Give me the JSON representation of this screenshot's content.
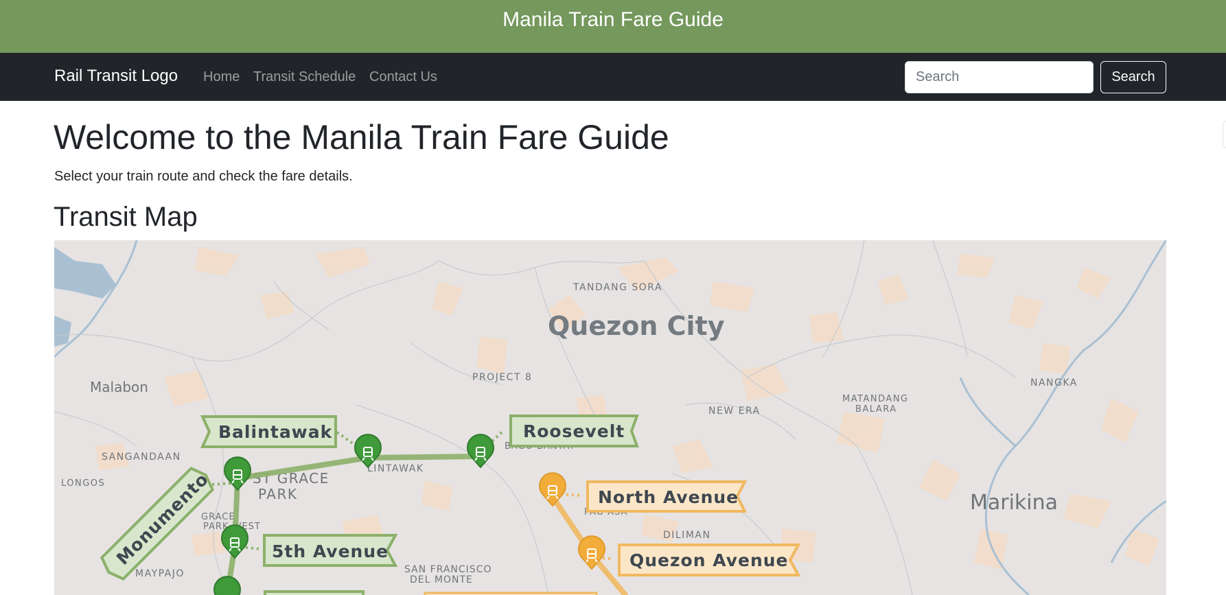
{
  "banner": {
    "title": "Manila Train Fare Guide"
  },
  "navbar": {
    "brand": "Rail Transit Logo",
    "links": [
      "Home",
      "Transit Schedule",
      "Contact Us"
    ],
    "search_placeholder": "Search",
    "search_button": "Search"
  },
  "main": {
    "heading": "Welcome to the Manila Train Fare Guide",
    "subtitle": "Select your train route and check the fare details.",
    "map_heading": "Transit Map"
  },
  "map": {
    "city_label": "Quezon City",
    "area_labels": {
      "malabon": "Malabon",
      "marikina": "Marikina",
      "tandang_sora": "TANDANG SORA",
      "project_8": "PROJECT 8",
      "new_era": "NEW ERA",
      "matandang_balara_1": "MATANDANG",
      "matandang_balara_2": "BALARA",
      "nangka": "NANGKA",
      "sangandaan": "SANGANDAAN",
      "longos": "LONGOS",
      "grace_park_1": "GRACE",
      "grace_park_2": "PARK WEST",
      "east_grace_park_1": "ST GRACE",
      "east_grace_park_2": "PARK",
      "balintawak_area": "LINTAWAK",
      "maypajo": "MAYPAJO",
      "diliman": "DILIMAN",
      "san_francisco_1": "SAN FRANCISCO",
      "san_francisco_2": "DEL MONTE",
      "bago_bantay": "BAGO BANTAY",
      "bago_pag_asa": "PAG-ASA"
    },
    "stations": {
      "balintawak": "Balintawak",
      "roosevelt": "Roosevelt",
      "monumento": "Monumento",
      "fifth_avenue": "5th Avenue",
      "north_avenue": "North Avenue",
      "quezon_avenue": "Quezon Avenue"
    },
    "colors": {
      "line1": "#8cb06a",
      "line1_marker": "#3f9a3a",
      "line1_label_bg": "#d8e6cc",
      "line3": "#f0b860",
      "line3_marker": "#f2ac3a",
      "line3_label_bg": "#fbe7c8",
      "water": "#a9c0d3",
      "roads": "#c6cbcf"
    },
    "icons": {
      "station_marker": "train-icon"
    }
  }
}
